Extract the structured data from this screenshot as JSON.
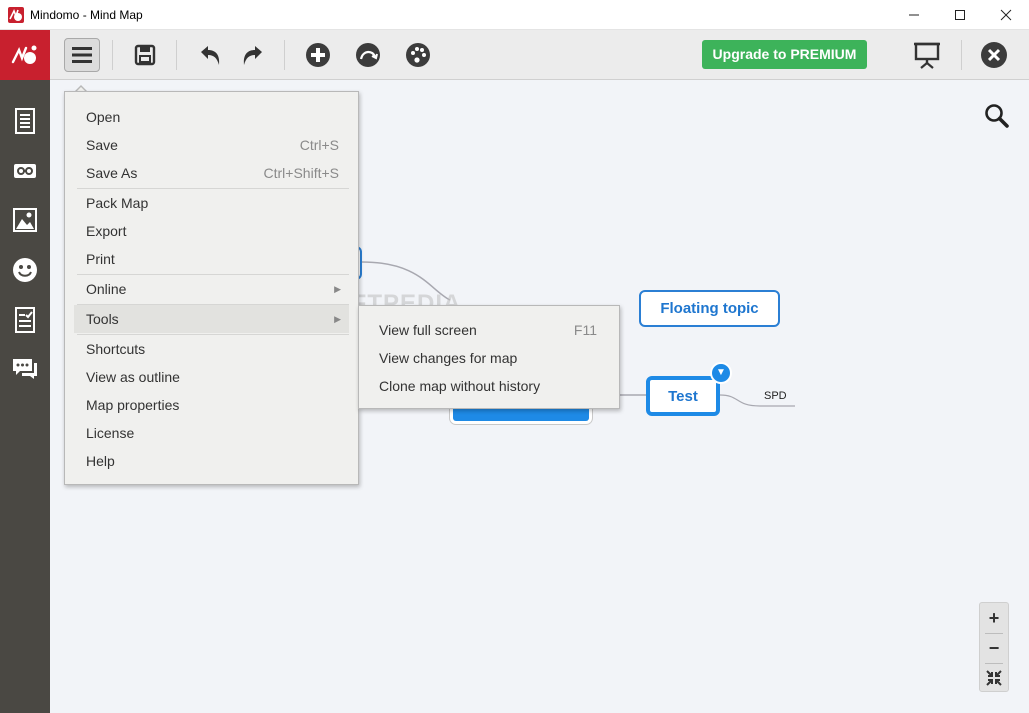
{
  "window": {
    "title": "Mindomo - Mind Map",
    "minimize_glyph": "—",
    "maximize_glyph": "☐",
    "close_glyph": "✕"
  },
  "toolbar": {
    "premium_label": "Upgrade to PREMIUM",
    "icons": [
      "menu-icon",
      "save-icon",
      "undo-icon",
      "redo-icon",
      "add-topic-icon",
      "relationship-icon",
      "theme-icon",
      "presentation-icon",
      "close-map-icon"
    ]
  },
  "sidebar": {
    "icons": [
      "notes-icon",
      "link-icon",
      "image-icon",
      "emoji-icon",
      "task-icon",
      "comment-icon"
    ]
  },
  "menu": {
    "items": [
      {
        "label": "Open",
        "shortcut": ""
      },
      {
        "label": "Save",
        "shortcut": "Ctrl+S"
      },
      {
        "label": "Save As",
        "shortcut": "Ctrl+Shift+S"
      },
      {
        "label": "Pack Map",
        "shortcut": ""
      },
      {
        "label": "Export",
        "shortcut": ""
      },
      {
        "label": "Print",
        "shortcut": ""
      },
      {
        "label": "Online",
        "shortcut": ""
      },
      {
        "label": "Tools",
        "shortcut": ""
      },
      {
        "label": "Shortcuts",
        "shortcut": ""
      },
      {
        "label": "View as outline",
        "shortcut": ""
      },
      {
        "label": "Map properties",
        "shortcut": ""
      },
      {
        "label": "License",
        "shortcut": ""
      },
      {
        "label": "Help",
        "shortcut": ""
      }
    ]
  },
  "submenu": {
    "items": [
      {
        "label": "View full screen",
        "shortcut": "F11"
      },
      {
        "label": "View changes for map",
        "shortcut": ""
      },
      {
        "label": "Clone map without history",
        "shortcut": ""
      }
    ]
  },
  "map": {
    "floating_topic": "Floating topic",
    "test_topic": "Test",
    "subtopic": "SPD"
  },
  "watermark": "SOFTPEDIA",
  "zoom": {
    "in_label": "+",
    "out_label": "−"
  },
  "colors": {
    "brand_red": "#c8202e",
    "premium_green": "#3db35a",
    "topic_blue": "#1e8ae6",
    "sidebar_dark": "#4a4843"
  }
}
